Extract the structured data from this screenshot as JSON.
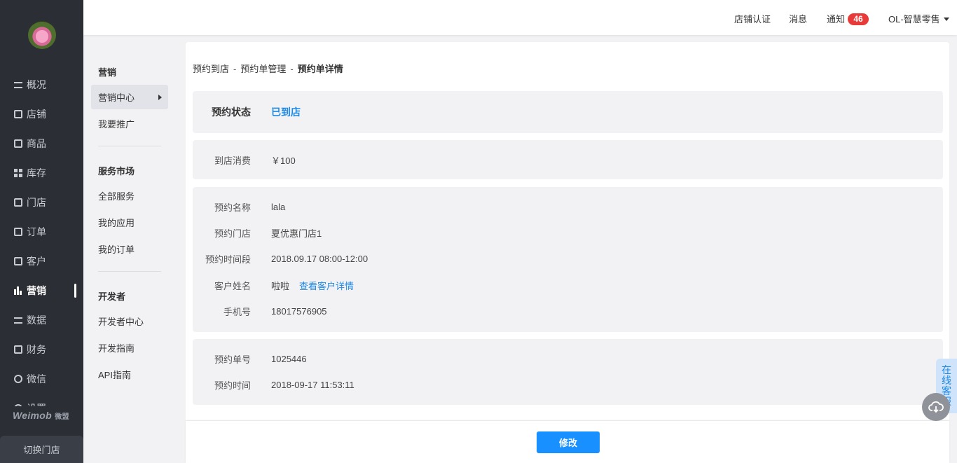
{
  "sidebar": {
    "items": [
      {
        "label": "概况",
        "icon": "overview-icon"
      },
      {
        "label": "店铺",
        "icon": "shop-icon"
      },
      {
        "label": "商品",
        "icon": "goods-icon"
      },
      {
        "label": "库存",
        "icon": "inventory-icon"
      },
      {
        "label": "门店",
        "icon": "store-icon"
      },
      {
        "label": "订单",
        "icon": "order-icon"
      },
      {
        "label": "客户",
        "icon": "customer-icon"
      },
      {
        "label": "营销",
        "icon": "marketing-icon",
        "active": true
      },
      {
        "label": "数据",
        "icon": "data-icon"
      },
      {
        "label": "财务",
        "icon": "finance-icon"
      },
      {
        "label": "微信",
        "icon": "wechat-icon"
      },
      {
        "label": "设置",
        "icon": "settings-icon"
      }
    ],
    "brand": "Weimob",
    "brand_cn": "微盟",
    "switch_store": "切换门店"
  },
  "subnav": {
    "group1_title": "营销",
    "group1_items": [
      "营销中心",
      "我要推广"
    ],
    "group2_title": "服务市场",
    "group2_items": [
      "全部服务",
      "我的应用",
      "我的订单"
    ],
    "group3_title": "开发者",
    "group3_items": [
      "开发者中心",
      "开发指南",
      "API指南"
    ]
  },
  "header": {
    "store_cert": "店铺认证",
    "messages": "消息",
    "notice": "通知",
    "notice_count": "46",
    "account": "OL-智慧零售"
  },
  "breadcrumb": {
    "level1": "预约到店",
    "level2": "预约单管理",
    "current": "预约单详情",
    "separator": "-"
  },
  "status": {
    "label": "预约状态",
    "value": "已到店"
  },
  "consumption": {
    "label": "到店消费",
    "value": "￥100"
  },
  "details": {
    "name_label": "预约名称",
    "name": "lala",
    "store_label": "预约门店",
    "store": "夏优惠门店1",
    "period_label": "预约时间段",
    "period": "2018.09.17 08:00-12:00",
    "customer_label": "客户姓名",
    "customer": "啦啦",
    "customer_link": "查看客户详情",
    "phone_label": "手机号",
    "phone": "18017576905"
  },
  "order": {
    "number_label": "预约单号",
    "number": "1025446",
    "time_label": "预约时间",
    "time": "2018-09-17 11:53:11"
  },
  "actions": {
    "edit": "修改"
  },
  "service": {
    "label": "在线客服"
  },
  "colors": {
    "accent": "#1890ff",
    "link": "#1e88e5",
    "badge": "#e93a3a",
    "sidebar": "#2b2e35"
  }
}
